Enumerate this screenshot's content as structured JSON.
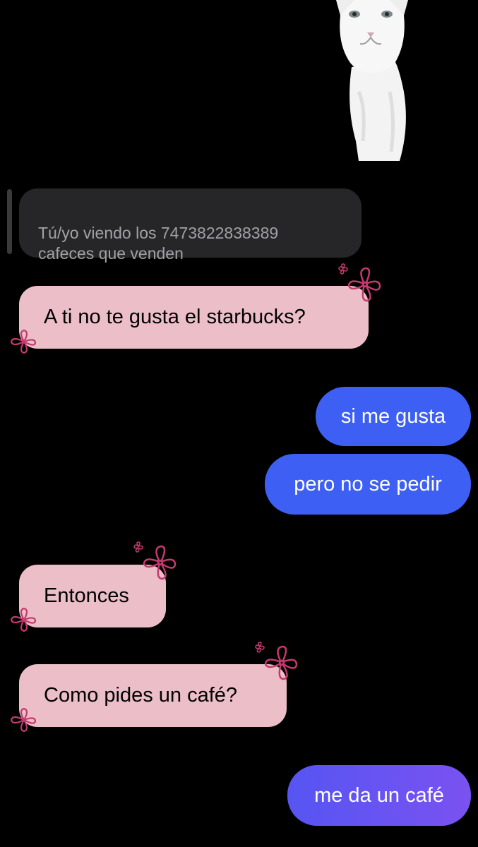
{
  "chat": {
    "reply_quote": {
      "text": "Tú/yo viendo los 7473822838389\ncafeces que  venden"
    },
    "messages": [
      {
        "side": "received",
        "text": "A ti no te gusta el starbucks?"
      },
      {
        "side": "sent",
        "text": "si me gusta"
      },
      {
        "side": "sent",
        "text": "pero no se pedir"
      },
      {
        "side": "received",
        "text": "Entonces"
      },
      {
        "side": "received",
        "text": "Como pides un café?"
      },
      {
        "side": "sent",
        "text": "me da un café"
      }
    ]
  },
  "colors": {
    "background": "#000000",
    "received_bubble": "#ebbec8",
    "sent_bubble": "#3e5ff4",
    "sent_bubble_gradient_end": "#7a52f1",
    "reply_bubble": "#262628",
    "flower_accent": "#c43a6e"
  },
  "icons": {
    "sticker": "white-cat-sticker",
    "decoration": "pink-flower-doodle"
  }
}
